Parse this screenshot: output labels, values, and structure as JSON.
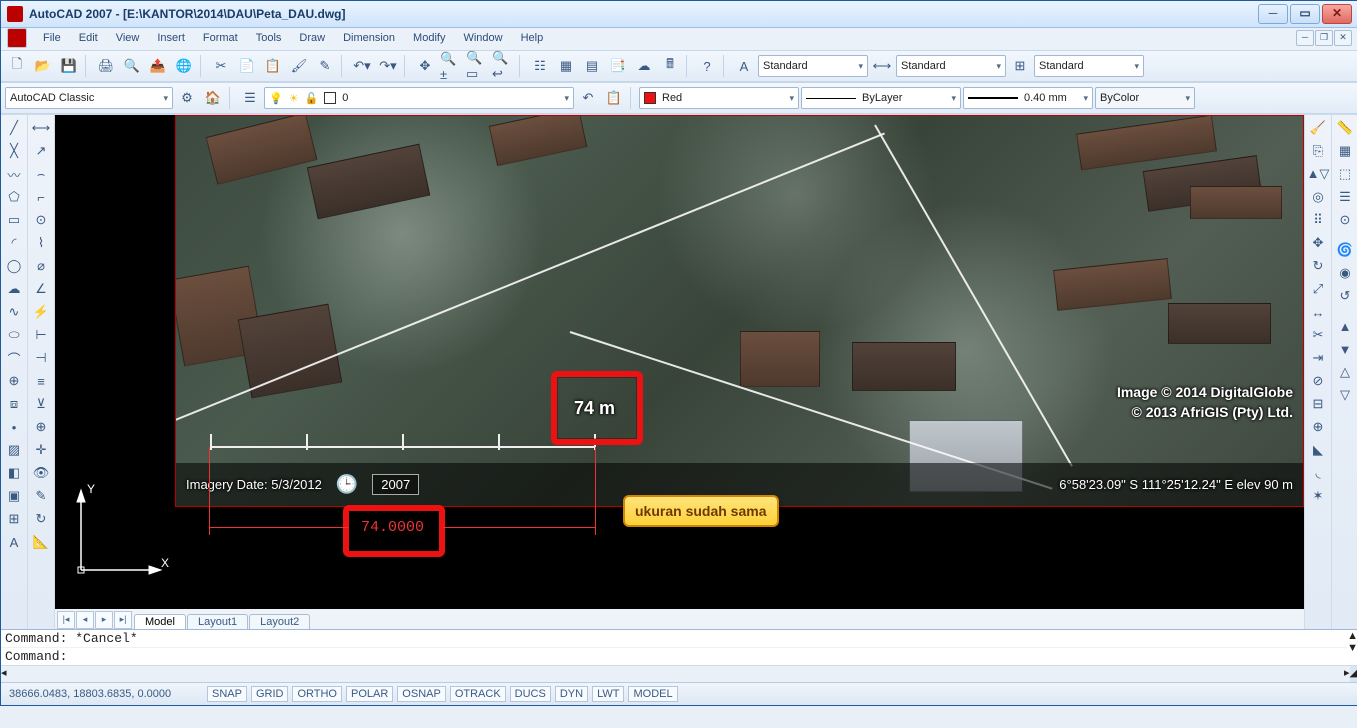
{
  "title": "AutoCAD 2007 - [E:\\KANTOR\\2014\\DAU\\Peta_DAU.dwg]",
  "menus": {
    "file": "File",
    "edit": "Edit",
    "view": "View",
    "insert": "Insert",
    "format": "Format",
    "tools": "Tools",
    "draw": "Draw",
    "dimension": "Dimension",
    "modify": "Modify",
    "window": "Window",
    "help": "Help"
  },
  "workspace": "AutoCAD Classic",
  "layer_current": "0",
  "textstyle": "Standard",
  "dimstyle": "Standard",
  "tablestyle": "Standard",
  "color_current": "Red",
  "linetype_current": "ByLayer",
  "lineweight_current": "0.40 mm",
  "plotstyle_current": "ByColor",
  "tabs": {
    "model": "Model",
    "layout1": "Layout1",
    "layout2": "Layout2"
  },
  "cmd_history": "Command: *Cancel*",
  "cmd_prompt": "Command:",
  "coords": "38666.0483, 18803.6835, 0.0000",
  "status_toggles": {
    "snap": "SNAP",
    "grid": "GRID",
    "ortho": "ORTHO",
    "polar": "POLAR",
    "osnap": "OSNAP",
    "otrack": "OTRACK",
    "ducs": "DUCS",
    "dyn": "DYN",
    "lwt": "LWT",
    "model": "MODEL"
  },
  "overlay": {
    "scale_label": "74 m",
    "img_date_label": "Imagery Date: 5/3/2012",
    "clock_year": "2007",
    "credit1": "Image © 2014 DigitalGlobe",
    "credit2": "© 2013 AfriGIS (Pty) Ltd.",
    "geo_readout": "6°58'23.09\" S  111°25'12.24\" E  elev    90 m",
    "dimension_value": "74.0000",
    "callout": "ukuran sudah sama"
  },
  "ucs": {
    "x": "X",
    "y": "Y"
  }
}
